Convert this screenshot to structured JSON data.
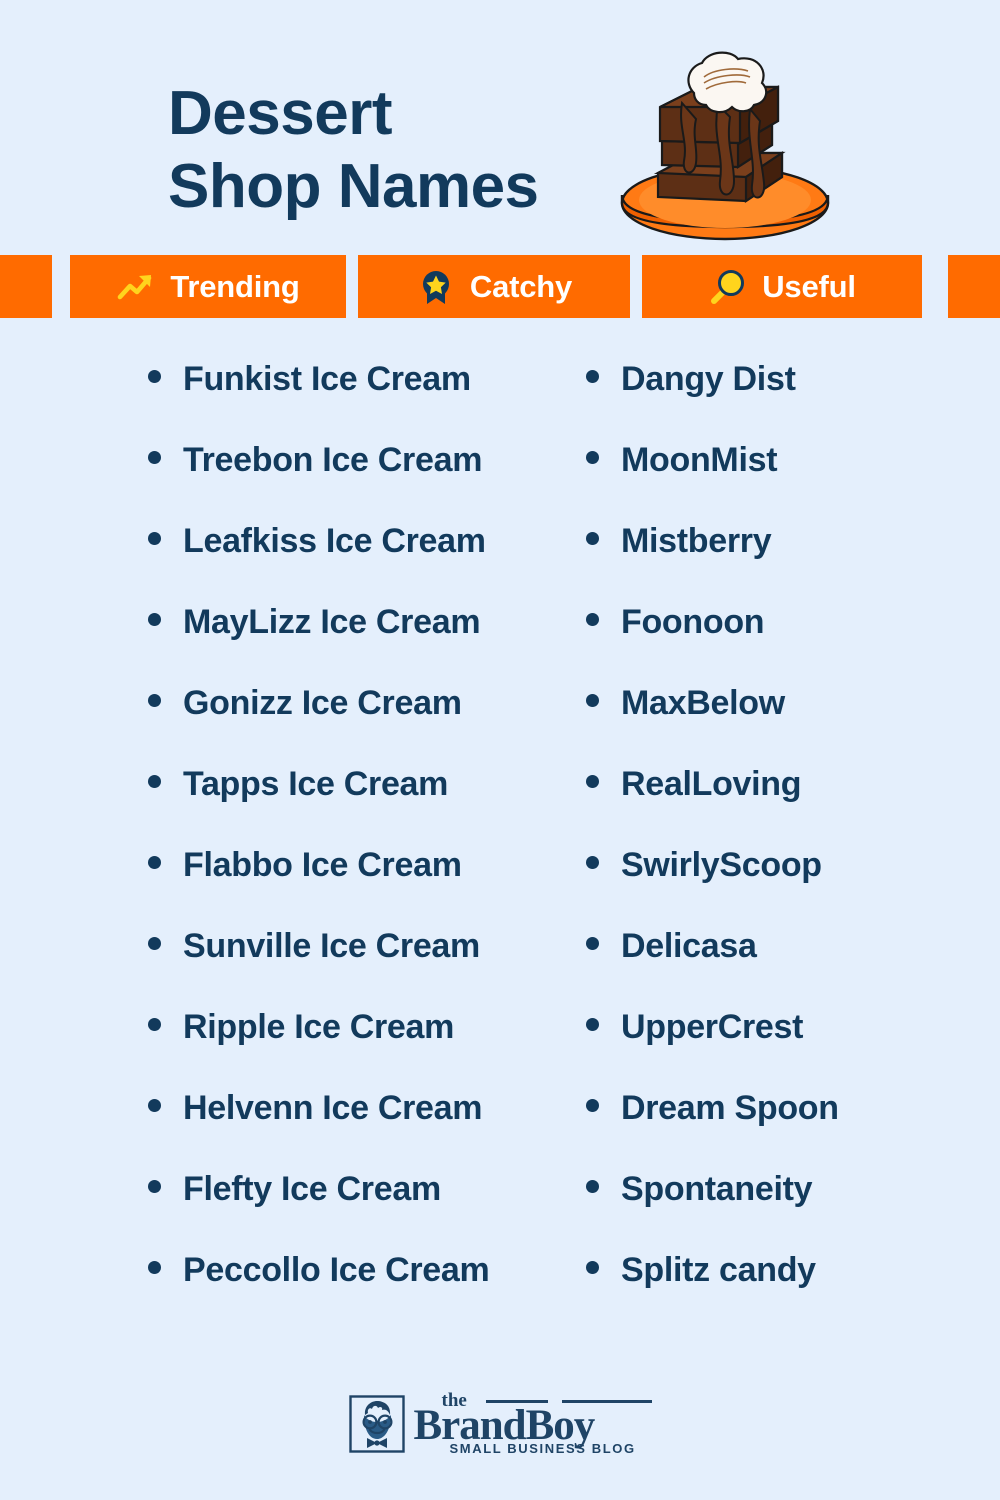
{
  "colors": {
    "background": "#e4effc",
    "accent_orange": "#ff6b00",
    "navy": "#123a5c",
    "yellow": "#ffd41d",
    "white": "#ffffff",
    "brownie_dark": "#5a2d14",
    "brownie_mid": "#7a3d18",
    "plate_orange": "#ff7a14",
    "cream": "#fbf7f2"
  },
  "header": {
    "title_line_1": "Dessert",
    "title_line_2": "Shop Names",
    "illustration": "brownie-stack-with-whipped-cream-on-plate"
  },
  "badges": [
    {
      "label": "Trending",
      "icon": "trending-up-icon"
    },
    {
      "label": "Catchy",
      "icon": "award-ribbon-icon"
    },
    {
      "label": "Useful",
      "icon": "magnifying-glass-icon"
    }
  ],
  "lists": {
    "left_column": [
      "Funkist Ice Cream",
      "Treebon Ice Cream",
      "Leafkiss Ice Cream",
      "MayLizz Ice Cream",
      "Gonizz Ice Cream",
      "Tapps Ice Cream",
      "Flabbo Ice Cream",
      "Sunville Ice Cream",
      "Ripple Ice Cream",
      "Helvenn Ice Cream",
      "Flefty Ice Cream",
      "Peccollo Ice Cream"
    ],
    "right_column": [
      "Dangy Dist",
      "MoonMist",
      "Mistberry",
      "Foonoon",
      "MaxBelow",
      "RealLoving",
      "SwirlyScoop",
      "Delicasa",
      "UpperCrest",
      "Dream Spoon",
      "Spontaneity",
      "Splitz candy"
    ]
  },
  "footer": {
    "logo_the": "the",
    "logo_brand": "BrandBoy",
    "logo_tagline": "SMALL BUSINESS BLOG",
    "logo_mark": "boy-face-with-glasses-and-bowtie-icon"
  }
}
